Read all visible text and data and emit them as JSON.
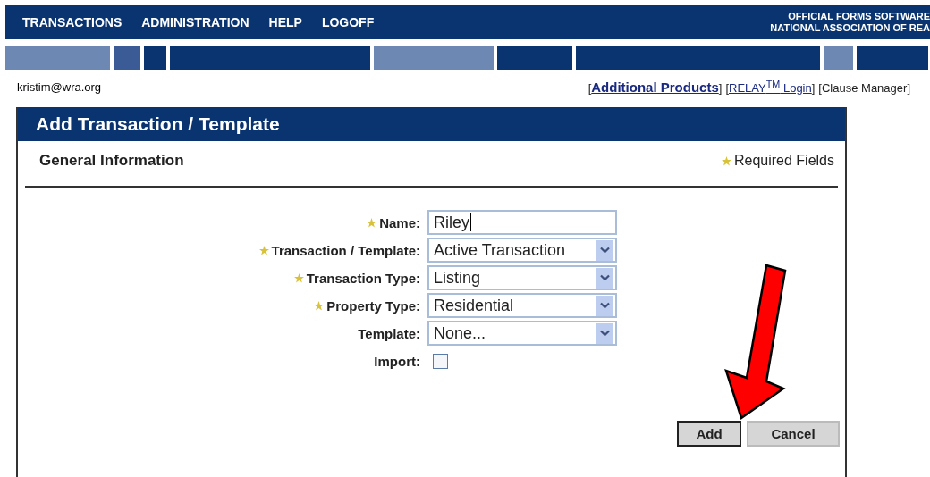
{
  "top_nav": {
    "items": [
      {
        "label": "TRANSACTIONS"
      },
      {
        "label": "ADMINISTRATION"
      },
      {
        "label": "HELP"
      },
      {
        "label": "LOGOFF"
      }
    ],
    "brand_lines": [
      "OFFICIAL FORMS SOFTWARE",
      "NATIONAL ASSOCIATION OF REA"
    ]
  },
  "user": "kristim@wra.org",
  "links": [
    {
      "prefix": "[",
      "text": "Additional Products",
      "suffix": "]",
      "bold": true
    },
    {
      "prefix": "[",
      "text": "RELAY$^{TM}$ Login",
      "suffix": "]",
      "bold": false
    },
    {
      "prefix": "[",
      "text": "Clause Manager",
      "suffix": "]",
      "bold": false,
      "kind": "plain"
    }
  ],
  "panel": {
    "title": "Add Transaction / Template",
    "section": "General Information",
    "required_note": "Required Fields"
  },
  "fields": [
    {
      "label": "Name:",
      "required": true,
      "kind": "text",
      "value": "Riley"
    },
    {
      "label": "Transaction / Template:",
      "required": true,
      "kind": "select",
      "value": "Active Transaction"
    },
    {
      "label": "Transaction Type:",
      "required": true,
      "kind": "select",
      "value": "Listing"
    },
    {
      "label": "Property Type:",
      "required": true,
      "kind": "select",
      "value": "Residential"
    },
    {
      "label": "Template:",
      "required": false,
      "kind": "select",
      "value": "None..."
    },
    {
      "label": "Import:",
      "required": false,
      "kind": "checkbox",
      "checked": false
    }
  ],
  "buttons": [
    {
      "label": "Add",
      "focused": true
    },
    {
      "label": "Cancel",
      "focused": false
    }
  ]
}
